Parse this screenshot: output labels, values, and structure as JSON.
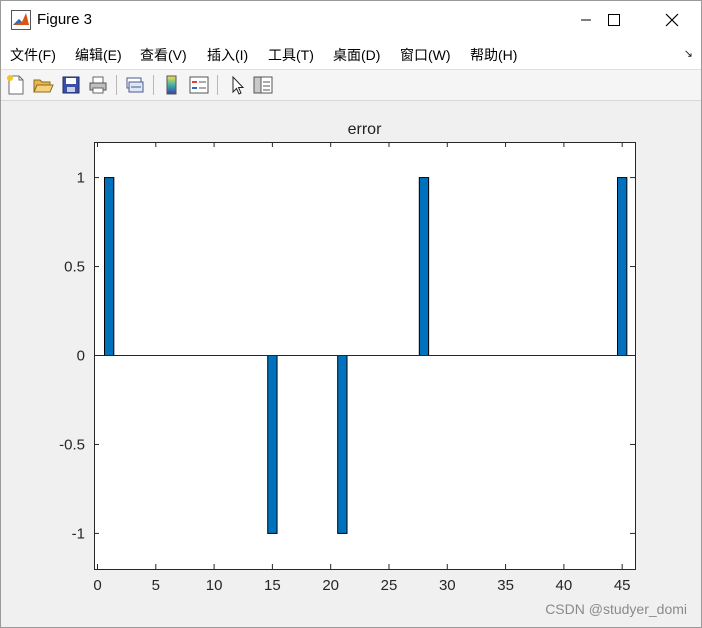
{
  "window": {
    "title": "Figure 3"
  },
  "menu": {
    "items": [
      "文件(F)",
      "编辑(E)",
      "查看(V)",
      "插入(I)",
      "工具(T)",
      "桌面(D)",
      "窗口(W)",
      "帮助(H)"
    ]
  },
  "toolbar": {
    "icons": [
      "new-figure-icon",
      "open-file-icon",
      "save-icon",
      "print-icon",
      "link-plot-icon",
      "colorbar-icon",
      "legend-icon",
      "pointer-icon",
      "property-editor-icon"
    ]
  },
  "chart_data": {
    "type": "bar",
    "title": "error",
    "xlabel": "",
    "ylabel": "",
    "xlim": [
      -0.3,
      46.1
    ],
    "ylim": [
      -1.2,
      1.2
    ],
    "xticks": [
      0,
      5,
      10,
      15,
      20,
      25,
      30,
      35,
      40,
      45
    ],
    "yticks": [
      1,
      0.5,
      0,
      -0.5,
      -1
    ],
    "ytick_labels": [
      "1",
      "0.5",
      "0",
      "-0.5",
      "-1"
    ],
    "bar_color": "#0072bd",
    "grid": false,
    "points": [
      {
        "x": 1,
        "y": 1
      },
      {
        "x": 15,
        "y": -1
      },
      {
        "x": 21,
        "y": -1
      },
      {
        "x": 28,
        "y": 1
      },
      {
        "x": 45,
        "y": 1
      }
    ]
  },
  "watermark": "CSDN @studyer_domi"
}
